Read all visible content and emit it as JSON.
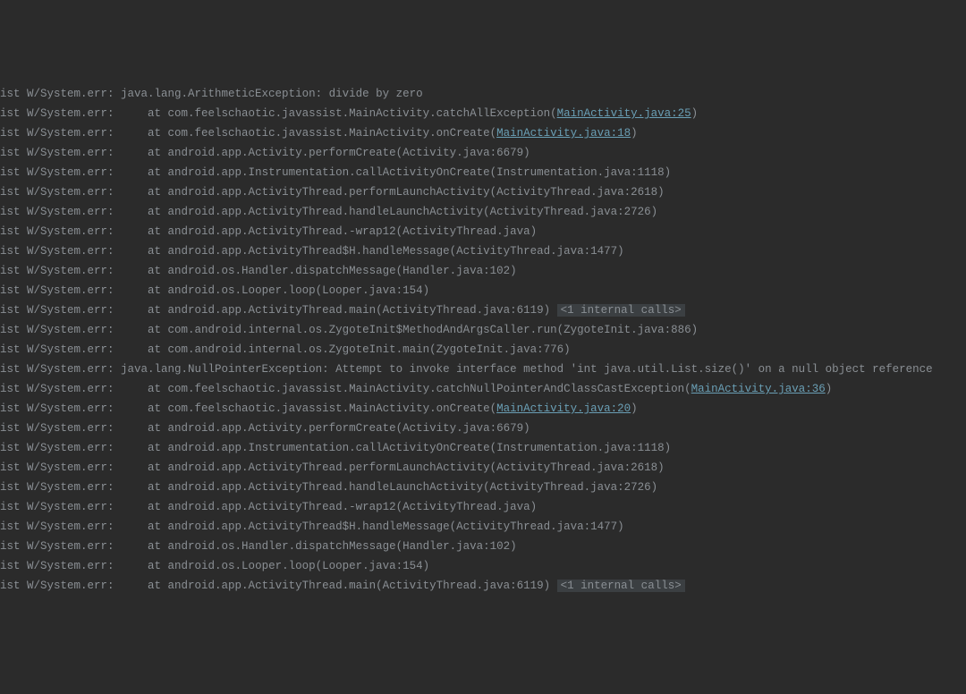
{
  "colors": {
    "bg": "#2b2b2b",
    "text": "#8a8f94",
    "link": "#6a9fb5",
    "highlight_bg": "#3b3f42"
  },
  "log": {
    "prefix": "ist W/System.err: ",
    "indent": "    ",
    "lines": [
      {
        "pre": "java.lang.ArithmeticException: divide by zero"
      },
      {
        "at": "com.feelschaotic.javassist.MainActivity.catchAllException",
        "paren_text": "",
        "link": "MainActivity.java:25",
        "paren_close": ")"
      },
      {
        "at": "com.feelschaotic.javassist.MainActivity.onCreate",
        "paren_text": "",
        "link": "MainActivity.java:18",
        "paren_close": ")"
      },
      {
        "at": "android.app.Activity.performCreate",
        "paren_text": "Activity.java:6679",
        "paren_close": ")"
      },
      {
        "at": "android.app.Instrumentation.callActivityOnCreate",
        "paren_text": "Instrumentation.java:1118",
        "paren_close": ")"
      },
      {
        "at": "android.app.ActivityThread.performLaunchActivity",
        "paren_text": "ActivityThread.java:2618",
        "paren_close": ")"
      },
      {
        "at": "android.app.ActivityThread.handleLaunchActivity",
        "paren_text": "ActivityThread.java:2726",
        "paren_close": ")"
      },
      {
        "at": "android.app.ActivityThread.-wrap12",
        "paren_text": "ActivityThread.java",
        "paren_close": ")"
      },
      {
        "at": "android.app.ActivityThread$H.handleMessage",
        "paren_text": "ActivityThread.java:1477",
        "paren_close": ")"
      },
      {
        "at": "android.os.Handler.dispatchMessage",
        "paren_text": "Handler.java:102",
        "paren_close": ")"
      },
      {
        "at": "android.os.Looper.loop",
        "paren_text": "Looper.java:154",
        "paren_close": ")"
      },
      {
        "at": "android.app.ActivityThread.main",
        "paren_text": "ActivityThread.java:6119",
        "paren_close": ")",
        "internal": "<1 internal calls>"
      },
      {
        "at": "com.android.internal.os.ZygoteInit$MethodAndArgsCaller.run",
        "paren_text": "ZygoteInit.java:886",
        "paren_close": ")"
      },
      {
        "at": "com.android.internal.os.ZygoteInit.main",
        "paren_text": "ZygoteInit.java:776",
        "paren_close": ")"
      },
      {
        "pre": "java.lang.NullPointerException: Attempt to invoke interface method 'int java.util.List.size()' on a null object reference"
      },
      {
        "at": "com.feelschaotic.javassist.MainActivity.catchNullPointerAndClassCastException",
        "paren_text": "",
        "link": "MainActivity.java:36",
        "paren_close": ")"
      },
      {
        "at": "com.feelschaotic.javassist.MainActivity.onCreate",
        "paren_text": "",
        "link": "MainActivity.java:20",
        "paren_close": ")"
      },
      {
        "at": "android.app.Activity.performCreate",
        "paren_text": "Activity.java:6679",
        "paren_close": ")"
      },
      {
        "at": "android.app.Instrumentation.callActivityOnCreate",
        "paren_text": "Instrumentation.java:1118",
        "paren_close": ")"
      },
      {
        "at": "android.app.ActivityThread.performLaunchActivity",
        "paren_text": "ActivityThread.java:2618",
        "paren_close": ")"
      },
      {
        "at": "android.app.ActivityThread.handleLaunchActivity",
        "paren_text": "ActivityThread.java:2726",
        "paren_close": ")"
      },
      {
        "at": "android.app.ActivityThread.-wrap12",
        "paren_text": "ActivityThread.java",
        "paren_close": ")"
      },
      {
        "at": "android.app.ActivityThread$H.handleMessage",
        "paren_text": "ActivityThread.java:1477",
        "paren_close": ")"
      },
      {
        "at": "android.os.Handler.dispatchMessage",
        "paren_text": "Handler.java:102",
        "paren_close": ")"
      },
      {
        "at": "android.os.Looper.loop",
        "paren_text": "Looper.java:154",
        "paren_close": ")"
      },
      {
        "at": "android.app.ActivityThread.main",
        "paren_text": "ActivityThread.java:6119",
        "paren_close": ")",
        "internal": "<1 internal calls>"
      }
    ]
  }
}
